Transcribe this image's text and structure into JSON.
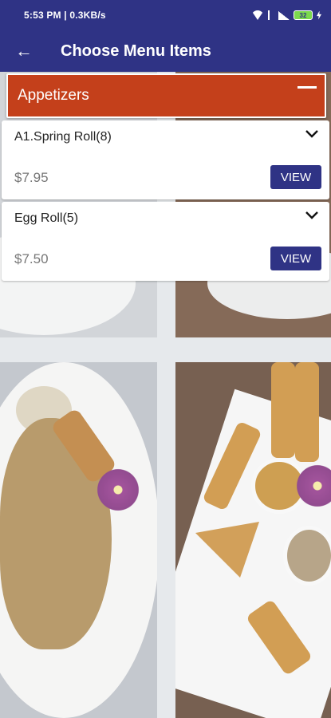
{
  "status_bar": {
    "time": "5:53 PM | 0.3KB/s",
    "battery": "32"
  },
  "app_bar": {
    "title": "Choose Menu Items",
    "back_icon": "back-arrow-icon"
  },
  "category": {
    "title": "Appetizers",
    "state": "expanded",
    "accent_color": "#c4401b",
    "items": [
      {
        "name": "A1.Spring Roll(8)",
        "price": "$7.95",
        "button": "VIEW"
      },
      {
        "name": "Egg Roll(5)",
        "price": "$7.50",
        "button": "VIEW"
      }
    ]
  },
  "colors": {
    "primary": "#2f3385",
    "header": "#c4401b"
  }
}
